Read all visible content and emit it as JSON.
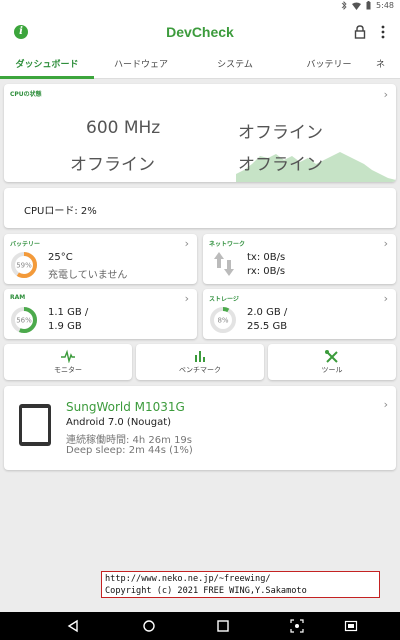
{
  "status_bar": {
    "time": "5:48",
    "icons": [
      "bluetooth-icon",
      "wifi-icon",
      "battery-icon"
    ]
  },
  "app": {
    "title": "DevCheck",
    "accent": "#3ca53c"
  },
  "tabs": [
    {
      "label": "ダッシュボード",
      "active": true
    },
    {
      "label": "ハードウェア",
      "active": false
    },
    {
      "label": "システム",
      "active": false
    },
    {
      "label": "バッテリー",
      "active": false
    },
    {
      "label": "ネ",
      "active": false
    }
  ],
  "cpu": {
    "label": "CPUの状態",
    "cores": [
      "600 MHz",
      "オフライン",
      "オフライン",
      "オフライン"
    ]
  },
  "cpu_load": {
    "text": "CPUロード: 2%"
  },
  "battery": {
    "label": "バッテリー",
    "gauge": "59%",
    "percent": 59,
    "temp": "25°C",
    "status": "充電していません"
  },
  "network": {
    "label": "ネットワーク",
    "tx": "tx: 0B/s",
    "rx": "rx: 0B/s"
  },
  "ram": {
    "label": "RAM",
    "gauge": "56%",
    "percent": 56,
    "used": "1.1 GB /",
    "total": "1.9 GB"
  },
  "storage": {
    "label": "ストレージ",
    "gauge": "8%",
    "percent": 8,
    "used": "2.0 GB /",
    "total": "25.5 GB"
  },
  "tools": [
    {
      "label": "モニター",
      "icon": "pulse-icon"
    },
    {
      "label": "ベンチマーク",
      "icon": "bar-chart-icon"
    },
    {
      "label": "ツール",
      "icon": "tools-icon"
    }
  ],
  "device": {
    "name": "SungWorld M1031G",
    "os": "Android 7.0 (Nougat)",
    "uptime": "連続稼働時間: 4h 26m 19s",
    "deep_sleep": "Deep sleep: 2m 44s (1%)"
  },
  "copyright": {
    "line1": "http://www.neko.ne.jp/~freewing/",
    "line2": "Copyright (c) 2021 FREE WING,Y.Sakamoto"
  }
}
